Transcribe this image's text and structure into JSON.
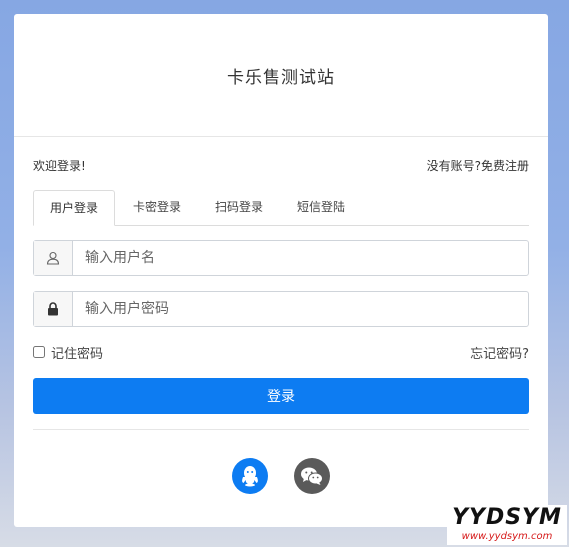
{
  "header": {
    "title": "卡乐售测试站"
  },
  "welcome": {
    "text": "欢迎登录!",
    "register": "没有账号?免费注册"
  },
  "tabs": [
    {
      "label": "用户登录",
      "active": true
    },
    {
      "label": "卡密登录",
      "active": false
    },
    {
      "label": "扫码登录",
      "active": false
    },
    {
      "label": "短信登陆",
      "active": false
    }
  ],
  "form": {
    "username_placeholder": "输入用户名",
    "password_placeholder": "输入用户密码",
    "username_value": "",
    "password_value": "",
    "remember_label": "记住密码",
    "remember_checked": false,
    "forgot_label": "忘记密码?",
    "login_label": "登录"
  },
  "social": [
    {
      "name": "qq",
      "icon": "qq-icon",
      "color": "#0d7cf2"
    },
    {
      "name": "wechat",
      "icon": "wechat-icon",
      "color": "#5a5a5a"
    }
  ],
  "watermark": {
    "main": "YYDSYM",
    "sub": "www.yydsym.com"
  },
  "colors": {
    "primary": "#0d7cf2",
    "background_top": "#86a7e3"
  }
}
